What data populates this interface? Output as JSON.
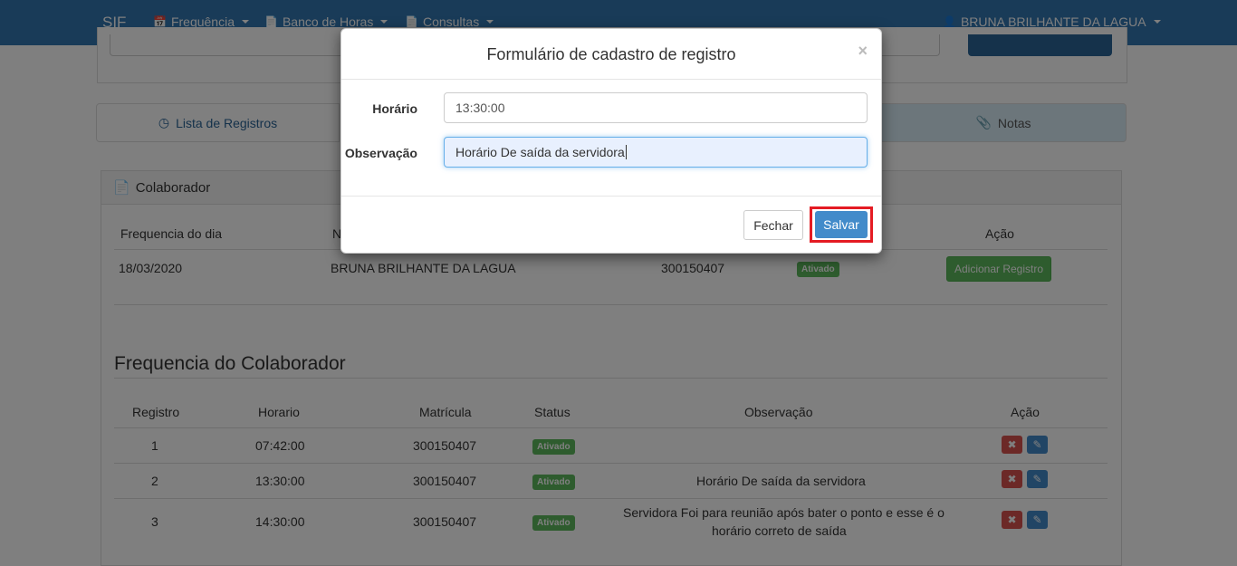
{
  "navbar": {
    "brand": "SIF",
    "menu": [
      {
        "label": "Frequência",
        "icon": "calendar-icon"
      },
      {
        "label": "Banco de Horas",
        "icon": "document-icon"
      },
      {
        "label": "Consultas",
        "icon": "document-icon"
      }
    ],
    "user": "BRUNA BRILHANTE DA LAGUA"
  },
  "tabs": {
    "registros": "Lista de Registros",
    "notas": "Notas"
  },
  "panel": {
    "heading": "Colaborador",
    "headers": {
      "frequencia_dia": "Frequencia do dia",
      "nome_partial": "N",
      "acao": "Ação"
    },
    "row": {
      "date": "18/03/2020",
      "name": "BRUNA BRILHANTE DA LAGUA",
      "matricula": "300150407",
      "status": "Ativado",
      "add_button": "Adicionar Registro"
    }
  },
  "frequencia": {
    "title": "Frequencia do Colaborador",
    "headers": [
      "Registro",
      "Horario",
      "Matrícula",
      "Status",
      "Observação",
      "Ação"
    ],
    "rows": [
      {
        "registro": "1",
        "horario": "07:42:00",
        "matricula": "300150407",
        "status": "Ativado",
        "observacao_line1": "",
        "observacao_line2": ""
      },
      {
        "registro": "2",
        "horario": "13:30:00",
        "matricula": "300150407",
        "status": "Ativado",
        "observacao_line1": "Horário De saída da servidora",
        "observacao_line2": ""
      },
      {
        "registro": "3",
        "horario": "14:30:00",
        "matricula": "300150407",
        "status": "Ativado",
        "observacao_line1": "Servidora Foi para reunião após bater o ponto e esse é o",
        "observacao_line2": "horário correto de saída"
      }
    ]
  },
  "modal": {
    "title": "Formulário de cadastro de registro",
    "close": "×",
    "horario_label": "Horário",
    "horario_value": "13:30:00",
    "observacao_label": "Observação",
    "observacao_value": "Horário De saída da servidora",
    "fechar": "Fechar",
    "salvar": "Salvar"
  },
  "colors": {
    "navbar": "#3276b1",
    "success": "#5cb85c",
    "primary": "#428bca",
    "danger": "#d9534f",
    "highlight": "#e41b23"
  }
}
